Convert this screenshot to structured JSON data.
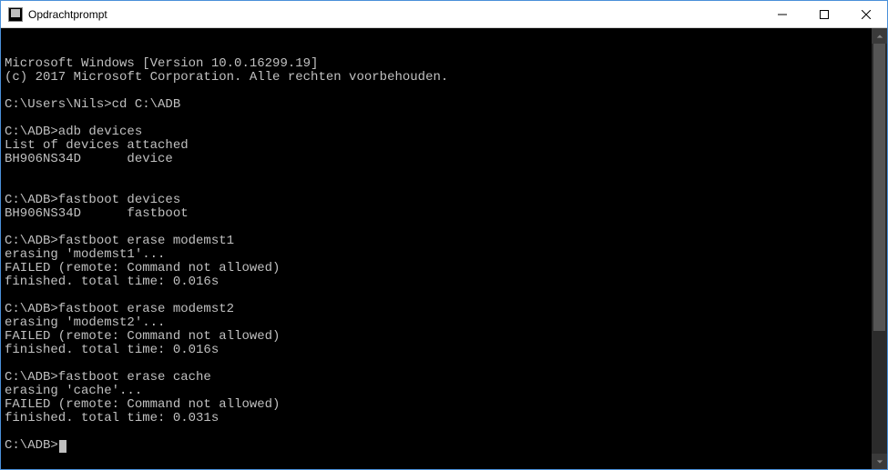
{
  "window": {
    "title": "Opdrachtprompt",
    "icon_name": "cmd-icon"
  },
  "controls": {
    "minimize": "Minimize",
    "maximize": "Maximize",
    "close": "Close"
  },
  "terminal": {
    "lines": [
      "Microsoft Windows [Version 10.0.16299.19]",
      "(c) 2017 Microsoft Corporation. Alle rechten voorbehouden.",
      "",
      "C:\\Users\\Nils>cd C:\\ADB",
      "",
      "C:\\ADB>adb devices",
      "List of devices attached",
      "BH906NS34D      device",
      "",
      "",
      "C:\\ADB>fastboot devices",
      "BH906NS34D      fastboot",
      "",
      "C:\\ADB>fastboot erase modemst1",
      "erasing 'modemst1'...",
      "FAILED (remote: Command not allowed)",
      "finished. total time: 0.016s",
      "",
      "C:\\ADB>fastboot erase modemst2",
      "erasing 'modemst2'...",
      "FAILED (remote: Command not allowed)",
      "finished. total time: 0.016s",
      "",
      "C:\\ADB>fastboot erase cache",
      "erasing 'cache'...",
      "FAILED (remote: Command not allowed)",
      "finished. total time: 0.031s",
      ""
    ],
    "prompt": "C:\\ADB>"
  }
}
